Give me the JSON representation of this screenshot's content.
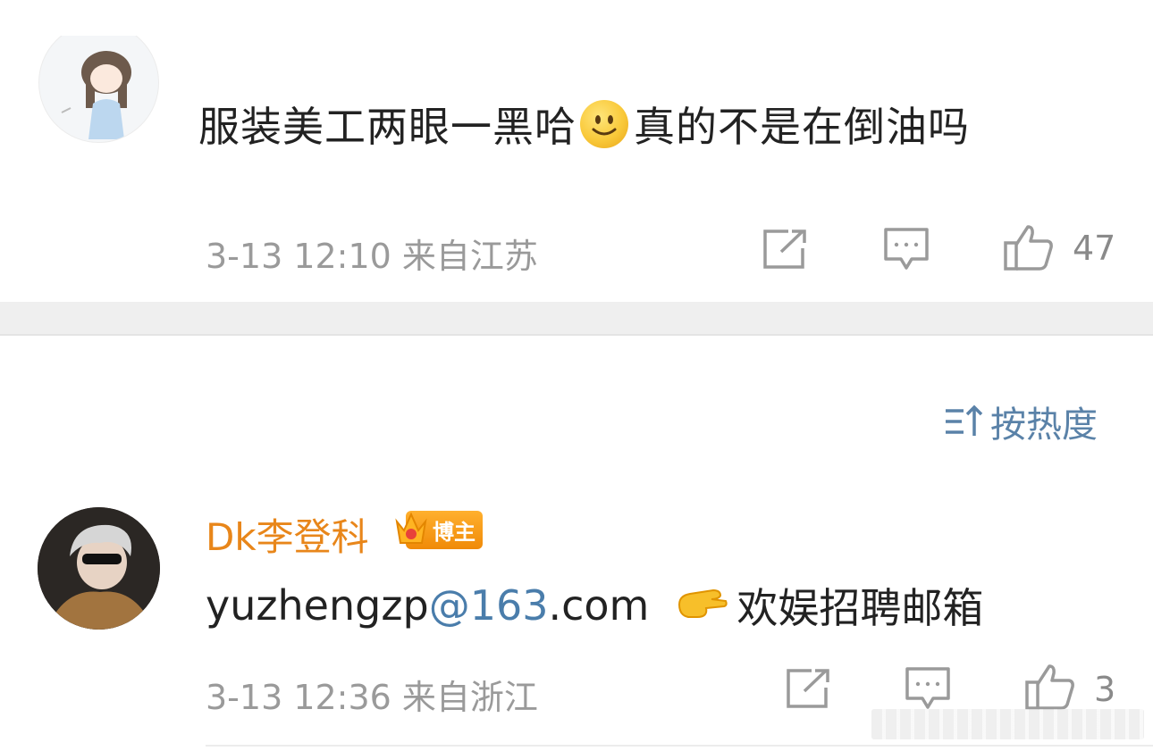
{
  "comment1": {
    "text_before_emoji": "服装美工两眼一黑哈",
    "emoji": "smile",
    "text_after_emoji": "真的不是在倒油吗",
    "meta": "3-13 12:10 来自江苏",
    "like_count": "47"
  },
  "sort": {
    "label": "按热度"
  },
  "comment2": {
    "username": "Dk李登科",
    "badge": "博主",
    "text_prefix": "yuzhengzp",
    "text_link": "@163",
    "text_suffix": ".com",
    "text_after_emoji": "欢娱招聘邮箱",
    "meta": "3-13 12:36 来自浙江",
    "like_count": "3"
  },
  "colors": {
    "username": "#e8861a",
    "link": "#4a7dab",
    "meta": "#9a9a9a",
    "separator": "#efefef"
  },
  "icons": [
    "share-icon",
    "comment-icon",
    "like-icon",
    "sort-icon",
    "smile-emoji-icon",
    "pointing-hand-icon",
    "crown-icon"
  ]
}
